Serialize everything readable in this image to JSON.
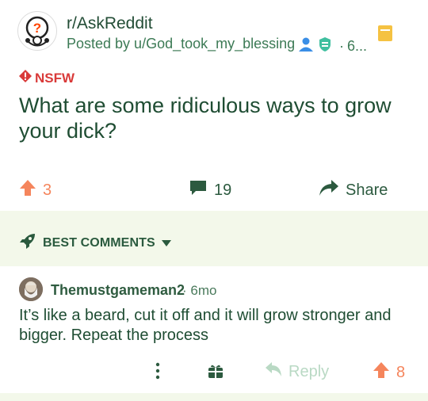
{
  "post": {
    "subreddit": "r/AskReddit",
    "posted_by": "Posted by u/God_took_my_blessing",
    "age": "6...",
    "nsfw_label": "NSFW",
    "title": "What are some ridiculous ways to grow your dick?",
    "upvotes": "3",
    "comments": "19",
    "share_label": "Share"
  },
  "comments_section": {
    "sort_label": "BEST COMMENTS"
  },
  "comment": {
    "author": "Themustgameman2",
    "age": "· 6mo",
    "body": "It’s like a beard, cut it off and it will grow stronger and bigger. Repeat the process",
    "reply_label": "Reply",
    "upvotes": "8"
  },
  "colors": {
    "text_dark": "#1f4d33",
    "accent_green": "#3c7a55",
    "upvote_orange": "#f5855c",
    "nsfw_red": "#d93a39",
    "band_bg": "#f3f8ea",
    "save_yellow": "#f5c242"
  },
  "icons": [
    "subreddit-avatar-icon",
    "user-icon",
    "mod-shield-icon",
    "save-icon",
    "nsfw-icon",
    "upvote-icon",
    "comment-icon",
    "share-icon",
    "rocket-icon",
    "chevron-down-icon",
    "more-icon",
    "award-icon",
    "reply-icon"
  ]
}
